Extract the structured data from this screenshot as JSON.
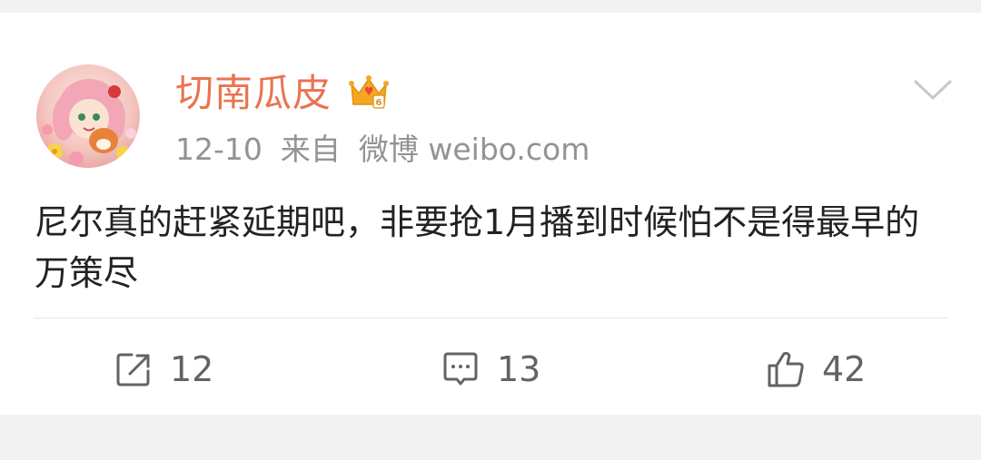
{
  "post": {
    "username": "切南瓜皮",
    "date": "12-10",
    "source_prefix": "来自",
    "source": "微博 weibo.com",
    "text": "尼尔真的赶紧延期吧，非要抢1月播到时候怕不是得最早的万策尽"
  },
  "actions": {
    "repost_count": "12",
    "comment_count": "13",
    "like_count": "42"
  },
  "icons": {
    "badge": "crown-level-6-icon",
    "menu": "chevron-down-icon",
    "repost": "repost-icon",
    "comment": "comment-icon",
    "like": "thumbs-up-icon"
  },
  "colors": {
    "username": "#eb7350",
    "meta": "#939393",
    "text": "#222222",
    "count": "#636363",
    "badge": "#f5a623"
  }
}
